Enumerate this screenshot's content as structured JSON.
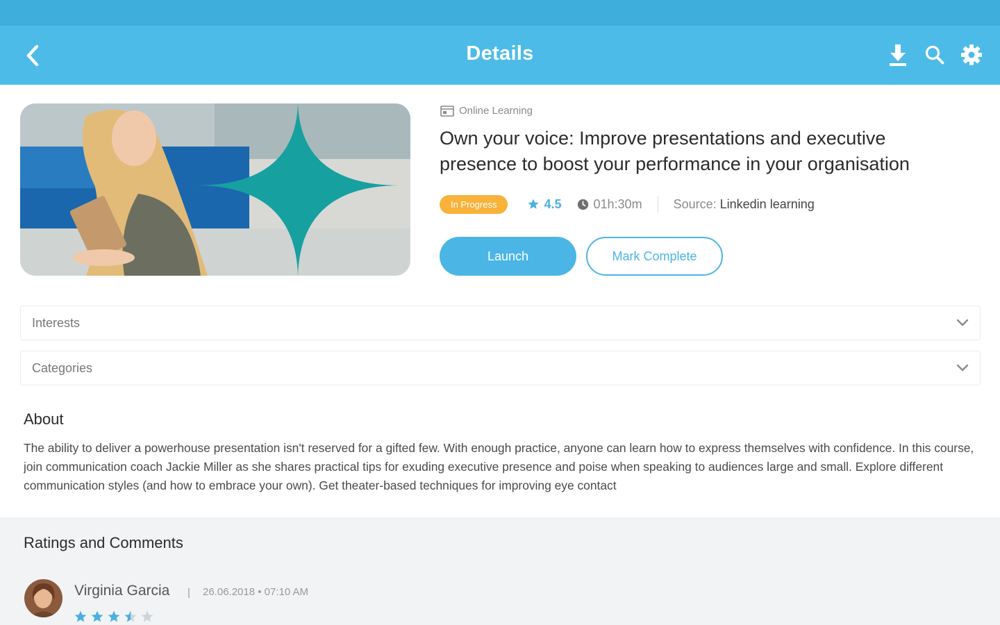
{
  "header": {
    "title": "Details",
    "icons": [
      "back-arrow-icon",
      "download-icon",
      "search-icon",
      "gear-icon"
    ],
    "colors": {
      "app_bar": "#4dbbe8",
      "status_bar": "#3eaedc"
    }
  },
  "course": {
    "type_label": "Online Learning",
    "title": "Own your voice: Improve presentations and executive presence to boost your performance in your organisation",
    "status": "In Progress",
    "rating": "4.5",
    "duration": "01h:30m",
    "source_label": "Source:",
    "source_value": "Linkedin learning",
    "launch_label": "Launch",
    "mark_complete_label": "Mark Complete",
    "colors": {
      "accent": "#4bb5e6",
      "badge": "#f9b23a"
    }
  },
  "filters": {
    "interests_label": "Interests",
    "categories_label": "Categories"
  },
  "about": {
    "title": "About",
    "text": "The ability to deliver a powerhouse presentation isn't reserved for a gifted few. With enough practice, anyone can learn how to express themselves with confidence. In this course, join communication coach Jackie Miller as she shares practical tips for exuding executive presence and poise when speaking to audiences large and small. Explore different communication styles (and how to embrace your own). Get theater-based techniques for improving eye contact"
  },
  "ratings": {
    "title": "Ratings and Comments",
    "comments": [
      {
        "name": "Virginia Garcia",
        "separator": "|",
        "date": "26.06.2018 • 07:10 AM",
        "stars": 3.5
      }
    ]
  }
}
